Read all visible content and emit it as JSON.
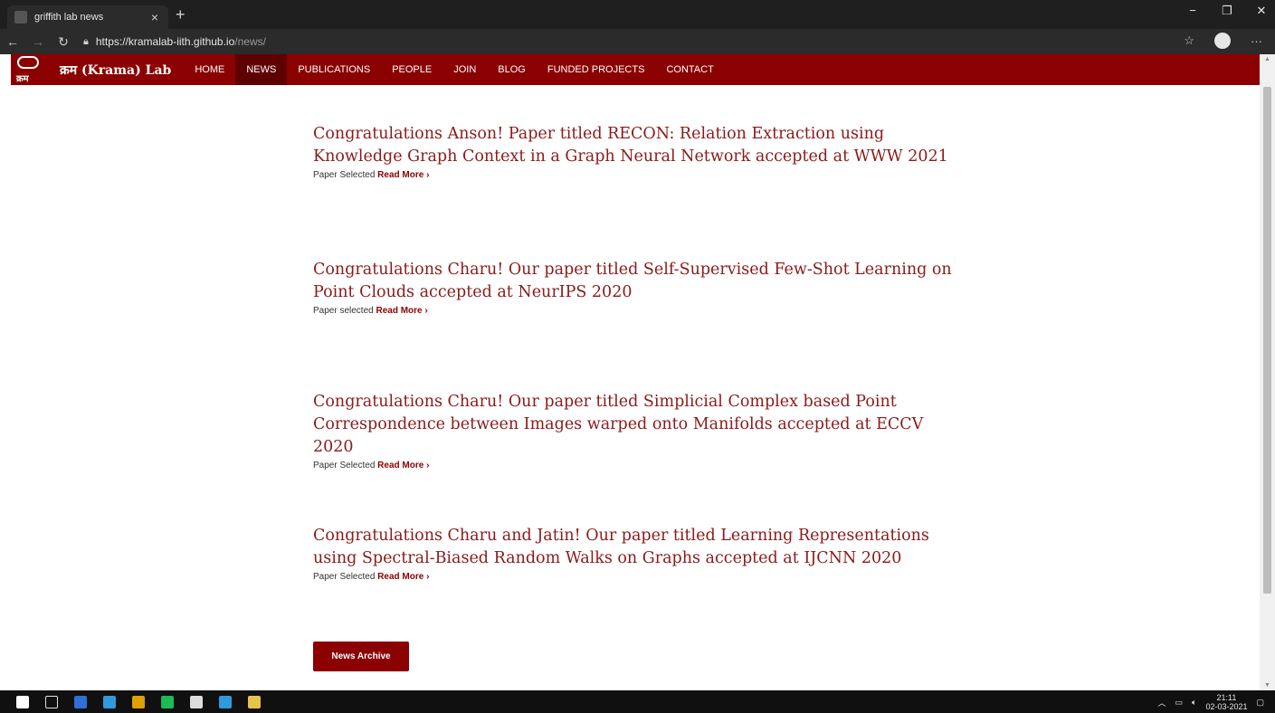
{
  "browser": {
    "tab_title": "griffith lab news",
    "tab_close": "×",
    "new_tab": "+",
    "url_host": "https://kramalab-iith.github.io",
    "url_path": "/news/",
    "window_controls": {
      "minimize": "−",
      "restore": "❐",
      "close": "✕"
    },
    "nav": {
      "back": "←",
      "forward": "→",
      "reload": "↻"
    },
    "extras": {
      "favorites": "☆",
      "menu": "···"
    }
  },
  "site": {
    "logo_text": "क्रम",
    "brand": "क्रम (Krama) Lab",
    "nav_items": [
      {
        "label": "HOME",
        "active": false
      },
      {
        "label": "NEWS",
        "active": true
      },
      {
        "label": "PUBLICATIONS",
        "active": false
      },
      {
        "label": "PEOPLE",
        "active": false
      },
      {
        "label": "JOIN",
        "active": false
      },
      {
        "label": "BLOG",
        "active": false
      },
      {
        "label": "FUNDED PROJECTS",
        "active": false
      },
      {
        "label": "CONTACT",
        "active": false
      }
    ]
  },
  "news": [
    {
      "title": "Congratulations Anson! Paper titled RECON: Relation Extraction using Knowledge Graph Context in a Graph Neural Network accepted at WWW 2021",
      "meta": "Paper Selected",
      "read_more": "Read More ›"
    },
    {
      "title": "Congratulations Charu! Our paper titled Self-Supervised Few-Shot Learning on Point Clouds accepted at NeurIPS 2020",
      "meta": "Paper selected",
      "read_more": "Read More ›"
    },
    {
      "title": "Congratulations Charu! Our paper titled Simplicial Complex based Point Correspondence between Images warped onto Manifolds accepted at ECCV 2020",
      "meta": "Paper Selected",
      "read_more": "Read More ›"
    },
    {
      "title": "Congratulations Charu and Jatin! Our paper titled Learning Representations using Spectral-Biased Random Walks on Graphs accepted at IJCNN 2020",
      "meta": "Paper Selected",
      "read_more": "Read More ›"
    }
  ],
  "archive_button": "News Archive",
  "taskbar": {
    "time": "21:11",
    "date": "02-03-2021",
    "colors": [
      "#2f6fd6",
      "#2f9bdc",
      "#e0a000",
      "#1db954",
      "#dddddd",
      "#2f9bdc",
      "#e8c34a"
    ]
  }
}
